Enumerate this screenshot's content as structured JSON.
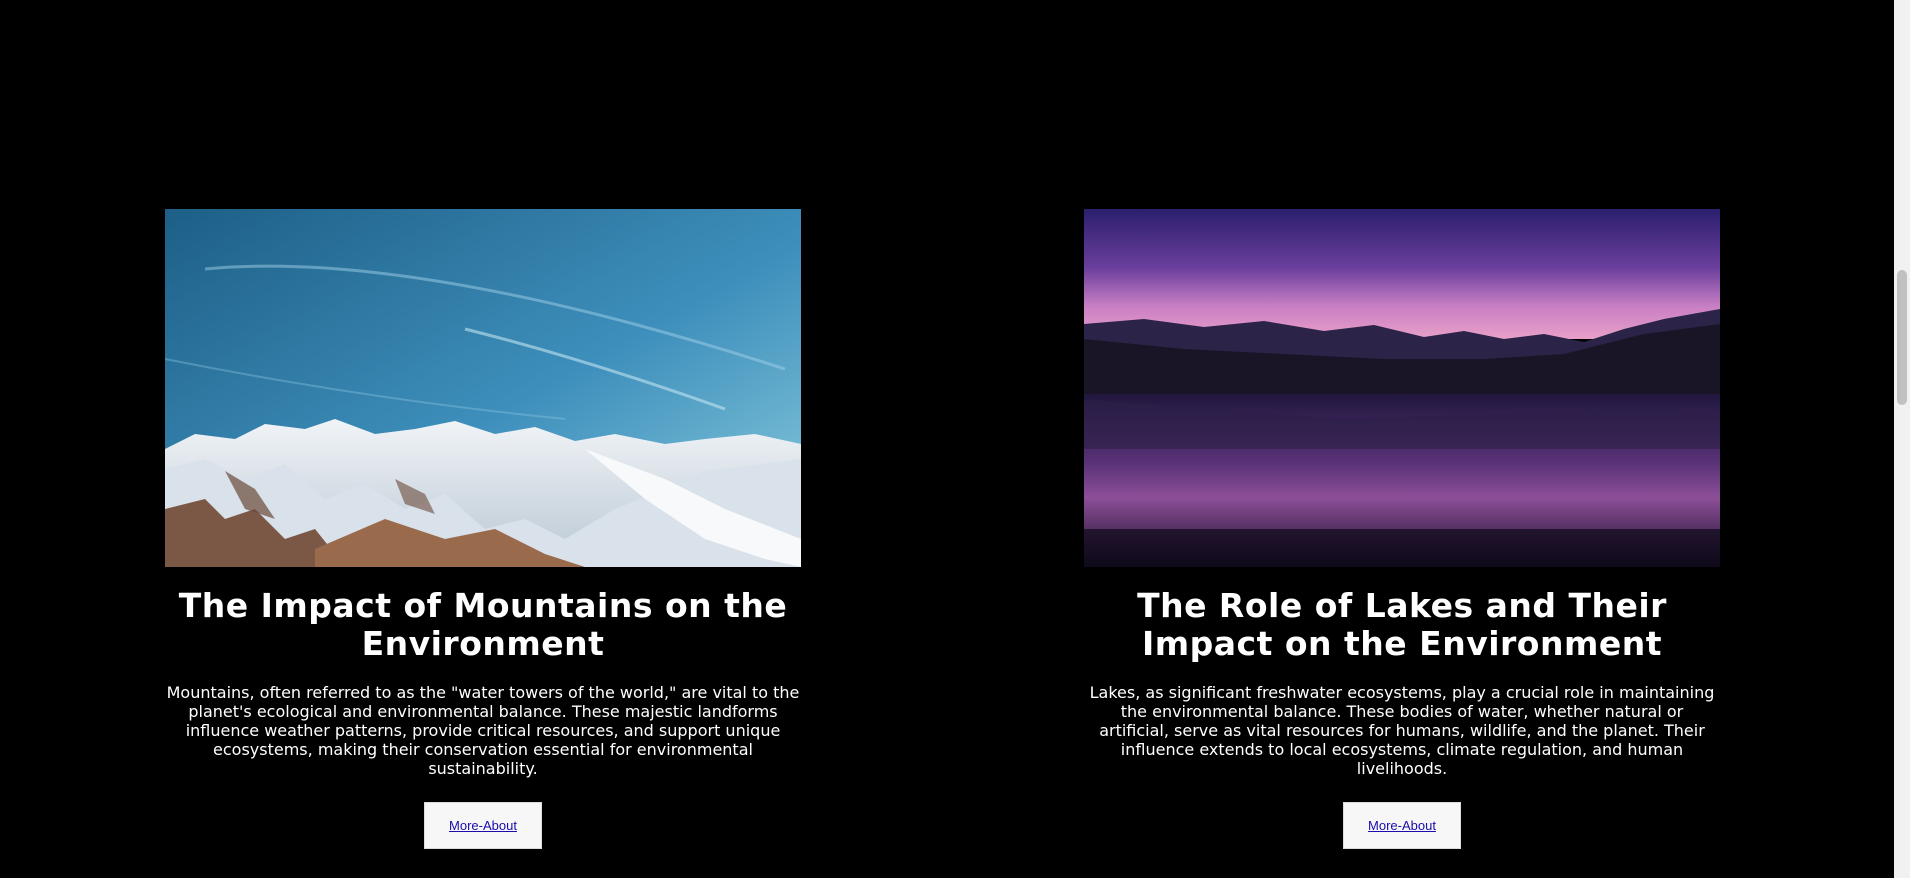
{
  "cards": [
    {
      "image": "snowy-mountain-range-photo",
      "title": "The Impact of Mountains on the Environment",
      "description": "Mountains, often referred to as the \"water towers of the world,\" are vital to the planet's ecological and environmental balance. These majestic landforms influence weather patterns, provide critical resources, and support unique ecosystems, making their conservation essential for environmental sustainability.",
      "button_label": "More-About"
    },
    {
      "image": "lake-sunset-photo",
      "title": "The Role of Lakes and Their Impact on the Environment",
      "description": "Lakes, as significant freshwater ecosystems, play a crucial role in maintaining the environmental balance. These bodies of water, whether natural or artificial, serve as vital resources for humans, wildlife, and the planet. Their influence extends to local ecosystems, climate regulation, and human livelihoods.",
      "button_label": "More-About"
    }
  ],
  "colors": {
    "background": "#000000",
    "text": "#ffffff",
    "button_bg": "#f7f7f7",
    "link": "#1a0dab"
  }
}
